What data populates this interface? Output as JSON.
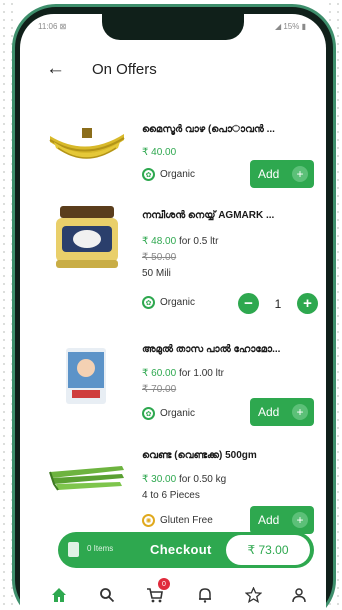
{
  "status": {
    "time": "11:06 ⊠",
    "right": "◢ 15% ▮"
  },
  "header": {
    "title": "On Offers"
  },
  "products": [
    {
      "name": "മൈസൂർ വാഴ (പൊ​ാവൻ ...",
      "price": "₹ 40.00",
      "unit": "",
      "mrp": "",
      "extra": "",
      "tag": "Organic",
      "action": "Add"
    },
    {
      "name": "നമ്പീശൻ നെയ്യ് AGMARK ...",
      "price": "₹ 48.00",
      "unit": "for 0.5 ltr",
      "mrp": "₹ 50.00",
      "extra": "50 Mili",
      "tag": "Organic",
      "qty": "1"
    },
    {
      "name": "അമുൽ താസ പാൽ ഹോമോ...",
      "price": "₹ 60.00",
      "unit": "for 1.00 ltr",
      "mrp": "₹ 70.00",
      "extra": "",
      "tag": "Organic",
      "action": "Add"
    },
    {
      "name": "വെണ്ട (വെണ്ടക്ക) 500gm",
      "price": "₹ 30.00",
      "unit": "for 0.50 kg",
      "mrp": "",
      "extra": "4 to 6 Pieces",
      "tag": "Gluten Free",
      "action": "Add"
    }
  ],
  "cart": {
    "items": "0 Items",
    "checkout": "Checkout",
    "total": "₹ 73.00",
    "badge": "0"
  },
  "colors": {
    "accent": "#2ea84f",
    "badge": "#e02b3c"
  }
}
